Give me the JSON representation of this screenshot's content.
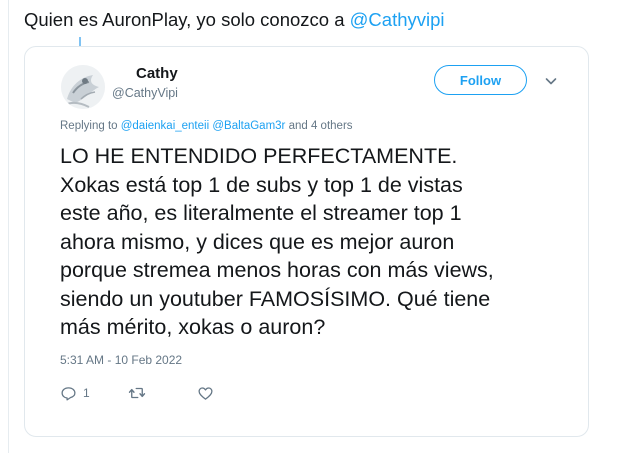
{
  "caption": {
    "text": "Quien es AuronPlay, yo solo conozco a ",
    "mention": "@Cathyvipi"
  },
  "tweet": {
    "author_name": "Cathy",
    "author_handle": "@CathyVipi",
    "follow_label": "Follow",
    "replying": {
      "prefix": "Replying to ",
      "mention_1": "@daienkai_enteii",
      "mention_2": "@BaltaGam3r",
      "suffix": " and 4 others"
    },
    "text": "LO HE ENTENDIDO PERFECTAMENTE.\nXokas está top 1 de subs y top 1 de vistas\neste año, es literalmente el streamer top 1\nahora mismo, y dices que es mejor auron\nporque stremea menos horas con más views,\nsiendo un youtuber FAMOSÍSIMO. Qué tiene\nmás mérito, xokas o auron?",
    "timestamp": "5:31 AM - 10 Feb 2022",
    "reply_count": "1"
  },
  "icons": [
    "reply-icon",
    "retweet-icon",
    "like-icon",
    "chevron-down-icon"
  ],
  "colors": {
    "accent": "#1da1f2",
    "muted": "#657786",
    "border": "#e1e8ed",
    "text": "#14171a"
  }
}
